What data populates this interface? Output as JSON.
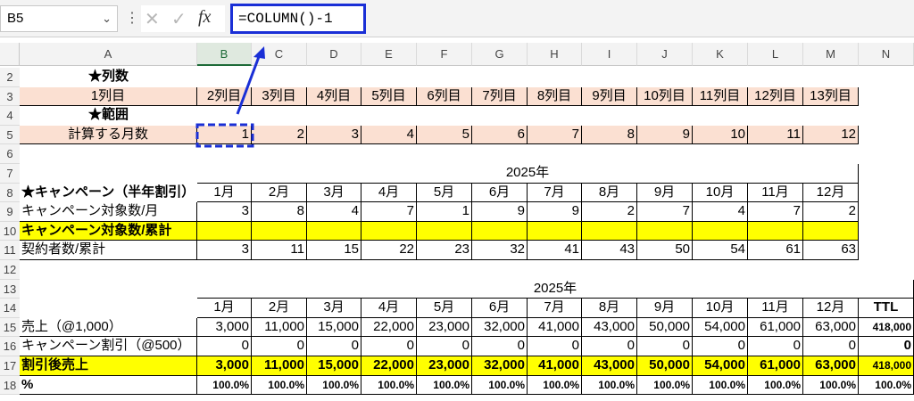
{
  "formula_bar": {
    "name_box": "B5",
    "formula": "=COLUMN()-1",
    "fx_label": "fx"
  },
  "column_headers": [
    "A",
    "B",
    "C",
    "D",
    "E",
    "F",
    "G",
    "H",
    "I",
    "J",
    "K",
    "L",
    "M",
    "N"
  ],
  "row_headers": [
    "2",
    "3",
    "4",
    "5",
    "6",
    "7",
    "8",
    "9",
    "10",
    "11",
    "12",
    "13",
    "14",
    "15",
    "16",
    "17",
    "18"
  ],
  "section1": {
    "title": "★列数",
    "label": "1列目",
    "columns": [
      "2列目",
      "3列目",
      "4列目",
      "5列目",
      "6列目",
      "7列目",
      "8列目",
      "9列目",
      "10列目",
      "11列目",
      "12列目",
      "13列目"
    ]
  },
  "section2": {
    "title": "★範囲",
    "label": "計算する月数",
    "values": [
      "1",
      "2",
      "3",
      "4",
      "5",
      "6",
      "7",
      "8",
      "9",
      "10",
      "11",
      "12"
    ]
  },
  "table1": {
    "year": "2025年",
    "title": "★キャンペーン（半年割引）",
    "months": [
      "1月",
      "2月",
      "3月",
      "4月",
      "5月",
      "6月",
      "7月",
      "8月",
      "9月",
      "10月",
      "11月",
      "12月"
    ],
    "rows": [
      {
        "label": "キャンペーン対象数/月",
        "values": [
          "3",
          "8",
          "4",
          "7",
          "1",
          "9",
          "9",
          "2",
          "7",
          "4",
          "7",
          "2"
        ]
      },
      {
        "label": "キャンペーン対象数/累計",
        "values": [
          "",
          "",
          "",
          "",
          "",
          "",
          "",
          "",
          "",
          "",
          "",
          ""
        ]
      },
      {
        "label": "契約者数/累計",
        "values": [
          "3",
          "11",
          "15",
          "22",
          "23",
          "32",
          "41",
          "43",
          "50",
          "54",
          "61",
          "63"
        ]
      }
    ]
  },
  "table2": {
    "year": "2025年",
    "months": [
      "1月",
      "2月",
      "3月",
      "4月",
      "5月",
      "6月",
      "7月",
      "8月",
      "9月",
      "10月",
      "11月",
      "12月"
    ],
    "ttl": "TTL",
    "rows": [
      {
        "label": "売上（@1,000）",
        "values": [
          "3,000",
          "11,000",
          "15,000",
          "22,000",
          "23,000",
          "32,000",
          "41,000",
          "43,000",
          "50,000",
          "54,000",
          "61,000",
          "63,000"
        ],
        "ttl": "418,000"
      },
      {
        "label": "キャンペーン割引（@500）",
        "values": [
          "0",
          "0",
          "0",
          "0",
          "0",
          "0",
          "0",
          "0",
          "0",
          "0",
          "0",
          "0"
        ],
        "ttl": "0"
      },
      {
        "label": "割引後売上",
        "values": [
          "3,000",
          "11,000",
          "15,000",
          "22,000",
          "23,000",
          "32,000",
          "41,000",
          "43,000",
          "50,000",
          "54,000",
          "61,000",
          "63,000"
        ],
        "ttl": "418,000"
      },
      {
        "label": "%",
        "values": [
          "100.0%",
          "100.0%",
          "100.0%",
          "100.0%",
          "100.0%",
          "100.0%",
          "100.0%",
          "100.0%",
          "100.0%",
          "100.0%",
          "100.0%",
          "100.0%"
        ],
        "ttl": "100.0%"
      }
    ]
  },
  "colors": {
    "highlight_blue": "#1a2fd6",
    "peach": "#fbe0d2",
    "yellow": "#ffff00",
    "selected_header": "#1d6a37"
  }
}
